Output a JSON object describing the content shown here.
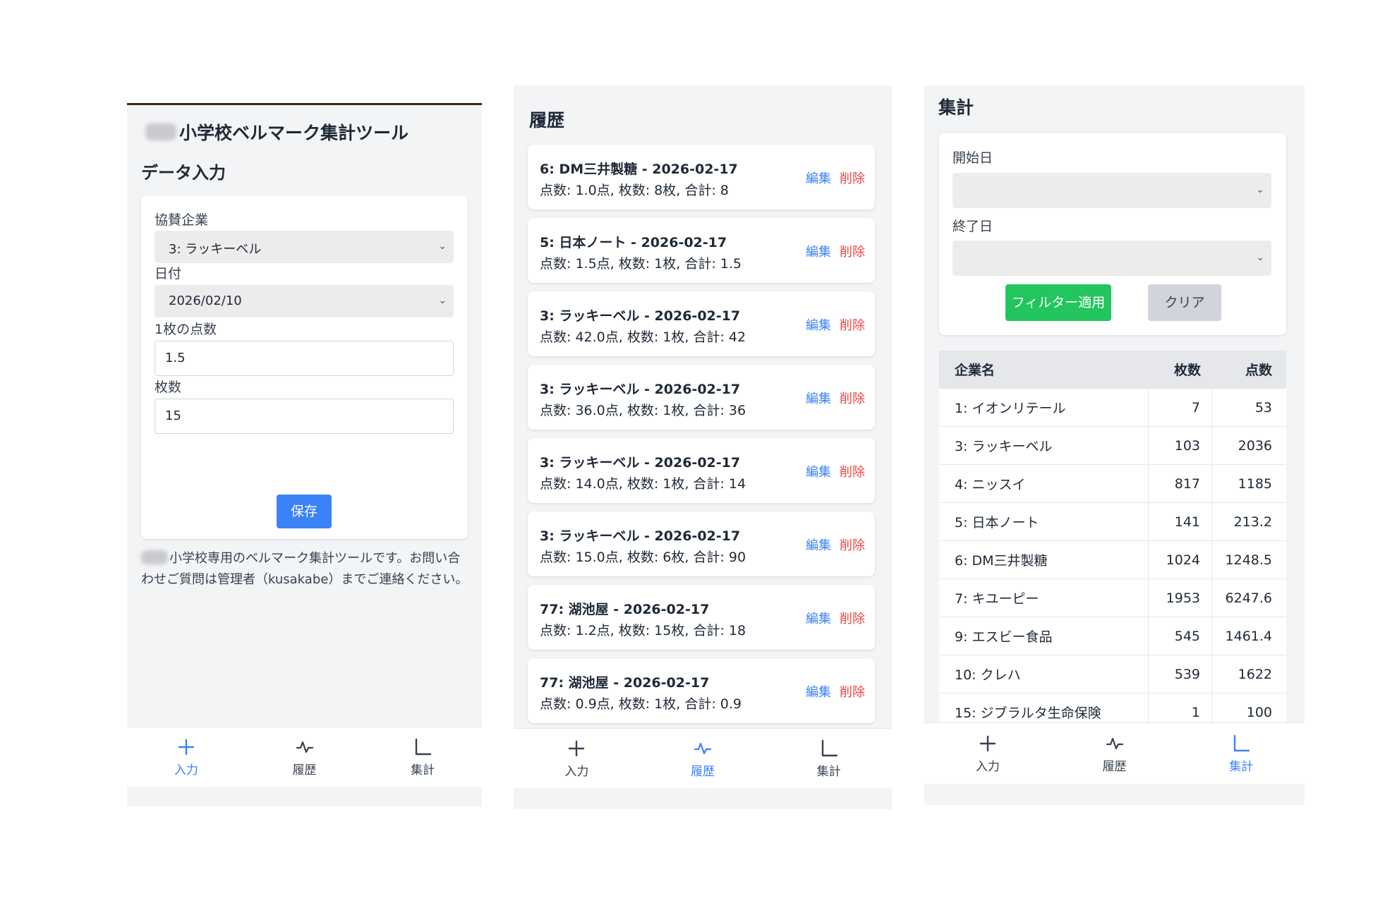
{
  "tabs": [
    {
      "label": "入力",
      "icon": "plus-icon"
    },
    {
      "label": "履歴",
      "icon": "activity-icon"
    },
    {
      "label": "集計",
      "icon": "chart-icon"
    }
  ],
  "colors": {
    "accent": "#3b82f6",
    "delete": "#ef4444",
    "apply": "#22c55e",
    "clear": "#d1d5db"
  },
  "input_screen": {
    "app_title": "小学校ベルマーク集計ツール",
    "section_title": "データ入力",
    "company_label": "協賛企業",
    "company_value": "3: ラッキーベル",
    "date_label": "日付",
    "date_value": "2026/02/10",
    "points_label": "1枚の点数",
    "points_value": "1.5",
    "count_label": "枚数",
    "count_value": "15",
    "save_label": "保存",
    "note": "小学校専用のベルマーク集計ツールです。お問い合わせご質問は管理者（kusakabe）までご連絡ください。"
  },
  "history_screen": {
    "title": "履歴",
    "edit_label": "編集",
    "delete_label": "削除",
    "items": [
      {
        "title": "6: DM三井製糖 - 2026-02-17",
        "detail": "点数: 1.0点, 枚数: 8枚, 合計: 8"
      },
      {
        "title": "5: 日本ノート - 2026-02-17",
        "detail": "点数: 1.5点, 枚数: 1枚, 合計: 1.5"
      },
      {
        "title": "3: ラッキーベル - 2026-02-17",
        "detail": "点数: 42.0点, 枚数: 1枚, 合計: 42"
      },
      {
        "title": "3: ラッキーベル - 2026-02-17",
        "detail": "点数: 36.0点, 枚数: 1枚, 合計: 36"
      },
      {
        "title": "3: ラッキーベル - 2026-02-17",
        "detail": "点数: 14.0点, 枚数: 1枚, 合計: 14"
      },
      {
        "title": "3: ラッキーベル - 2026-02-17",
        "detail": "点数: 15.0点, 枚数: 6枚, 合計: 90"
      },
      {
        "title": "77: 湖池屋 - 2026-02-17",
        "detail": "点数: 1.2点, 枚数: 15枚, 合計: 18"
      },
      {
        "title": "77: 湖池屋 - 2026-02-17",
        "detail": "点数: 0.9点, 枚数: 1枚, 合計: 0.9"
      }
    ]
  },
  "summary_screen": {
    "title": "集計",
    "start_label": "開始日",
    "start_value": "",
    "end_label": "終了日",
    "end_value": "",
    "apply_label": "フィルター適用",
    "clear_label": "クリア",
    "columns": [
      "企業名",
      "枚数",
      "点数"
    ],
    "rows": [
      [
        "1: イオンリテール",
        "7",
        "53"
      ],
      [
        "3: ラッキーベル",
        "103",
        "2036"
      ],
      [
        "4: ニッスイ",
        "817",
        "1185"
      ],
      [
        "5: 日本ノート",
        "141",
        "213.2"
      ],
      [
        "6: DM三井製糖",
        "1024",
        "1248.5"
      ],
      [
        "7: キユーピー",
        "1953",
        "6247.6"
      ],
      [
        "9: エスビー食品",
        "545",
        "1461.4"
      ],
      [
        "10: クレハ",
        "539",
        "1622"
      ],
      [
        "15: ジブラルタ生命保険",
        "1",
        "100"
      ]
    ]
  }
}
